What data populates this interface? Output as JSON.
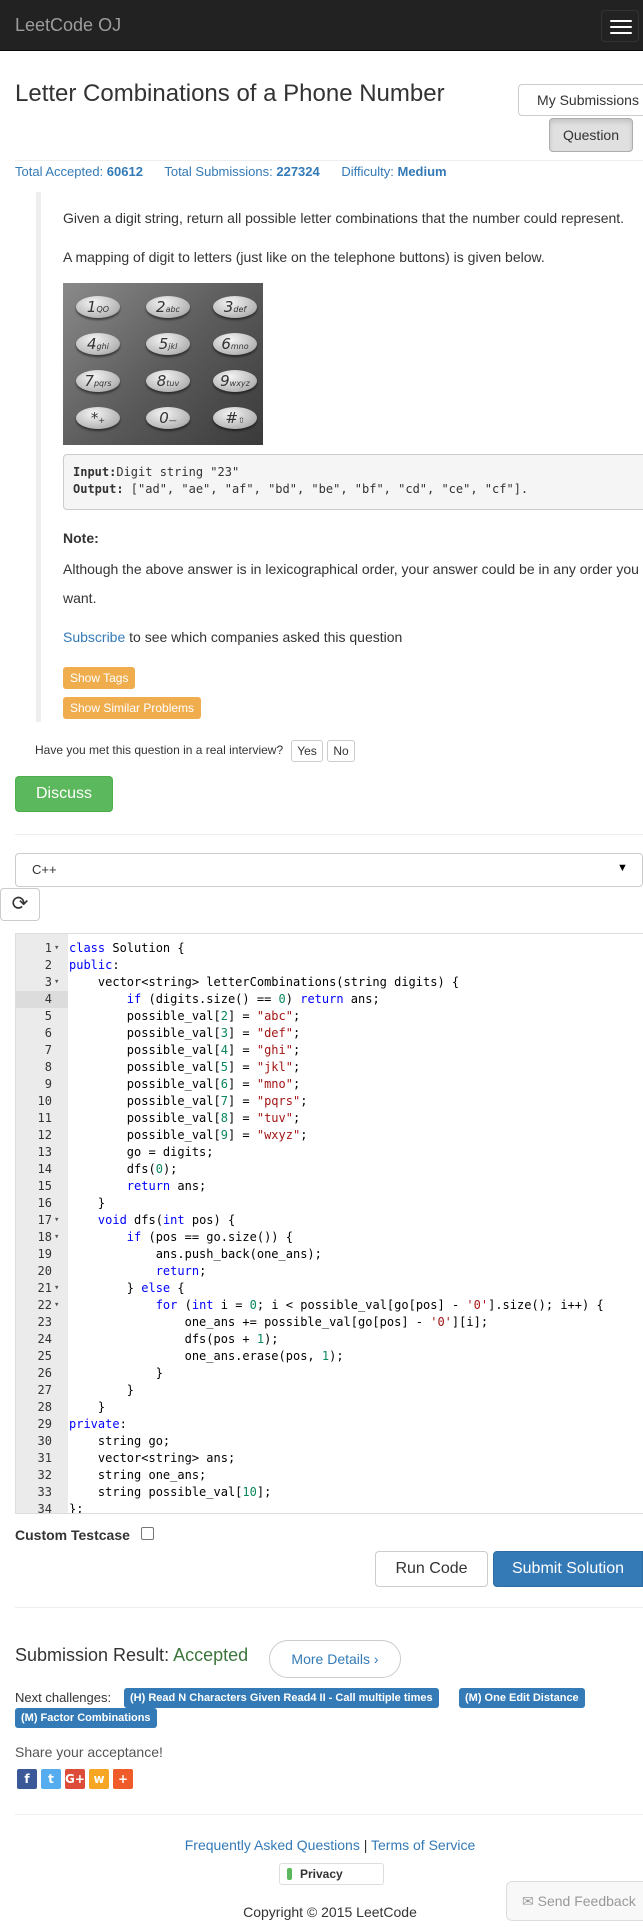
{
  "navbar": {
    "brand": "LeetCode OJ"
  },
  "question": {
    "title": "Letter Combinations of a Phone Number",
    "my_submissions_label": "My Submissions",
    "question_label": "Question",
    "stats": {
      "accepted_label": "Total Accepted:",
      "accepted_value": "60612",
      "submissions_label": "Total Submissions:",
      "submissions_value": "227324",
      "difficulty_label": "Difficulty:",
      "difficulty_value": "Medium"
    },
    "description": {
      "line1": "Given a digit string, return all possible letter combinations that the number could represent.",
      "line2": "A mapping of digit to letters (just like on the telephone buttons) is given below.",
      "keypad": [
        {
          "digit": "1",
          "letters": "QO"
        },
        {
          "digit": "2",
          "letters": "abc"
        },
        {
          "digit": "3",
          "letters": "def"
        },
        {
          "digit": "4",
          "letters": "ghi"
        },
        {
          "digit": "5",
          "letters": "jkl"
        },
        {
          "digit": "6",
          "letters": "mno"
        },
        {
          "digit": "7",
          "letters": "pqrs"
        },
        {
          "digit": "8",
          "letters": "tuv"
        },
        {
          "digit": "9",
          "letters": "wxyz"
        },
        {
          "digit": "*",
          "letters": "+"
        },
        {
          "digit": "0",
          "letters": "—"
        },
        {
          "digit": "#",
          "letters": "⇧"
        }
      ],
      "input_label": "Input:",
      "input_value": "Digit string \"23\"",
      "output_label": "Output:",
      "output_value": " [\"ad\", \"ae\", \"af\", \"bd\", \"be\", \"bf\", \"cd\", \"ce\", \"cf\"].",
      "note_label": "Note:",
      "note_line1": "Although the above answer is in lexicographical order, your answer could be in any order you",
      "note_line2": "want.",
      "subscribe_link": "Subscribe",
      "subscribe_text": " to see which companies asked this question",
      "show_tags_label": "Show Tags",
      "show_similar_label": "Show Similar Problems"
    },
    "interview_question": "Have you met this question in a real interview?",
    "yes_label": "Yes",
    "no_label": "No",
    "discuss_label": "Discuss"
  },
  "editor": {
    "language": "C++",
    "active_line": 4,
    "lines": [
      "class Solution {",
      "public:",
      "    vector<string> letterCombinations(string digits) {",
      "        if (digits.size() == 0) return ans;",
      "        possible_val[2] = \"abc\";",
      "        possible_val[3] = \"def\";",
      "        possible_val[4] = \"ghi\";",
      "        possible_val[5] = \"jkl\";",
      "        possible_val[6] = \"mno\";",
      "        possible_val[7] = \"pqrs\";",
      "        possible_val[8] = \"tuv\";",
      "        possible_val[9] = \"wxyz\";",
      "        go = digits;",
      "        dfs(0);",
      "        return ans;",
      "    }",
      "    void dfs(int pos) {",
      "        if (pos == go.size()) {",
      "            ans.push_back(one_ans);",
      "            return;",
      "        } else {",
      "            for (int i = 0; i < possible_val[go[pos] - '0'].size(); i++) {",
      "                one_ans += possible_val[go[pos] - '0'][i];",
      "                dfs(pos + 1);",
      "                one_ans.erase(pos, 1);",
      "            }",
      "        }",
      "    }",
      "private:",
      "    string go;",
      "    vector<string> ans;",
      "    string one_ans;",
      "    string possible_val[10];",
      "};"
    ],
    "folds": [
      1,
      3,
      17,
      18,
      21,
      22
    ]
  },
  "controls": {
    "custom_testcase_label": "Custom Testcase",
    "run_code_label": "Run Code",
    "submit_label": "Submit Solution"
  },
  "result": {
    "label": "Submission Result: ",
    "value": "Accepted",
    "more_details_label": "More Details",
    "next_label": "Next challenges:",
    "challenges": [
      "(H) Read N Characters Given Read4 II - Call multiple times",
      "(M) One Edit Distance",
      "(M) Factor Combinations"
    ],
    "share_label": "Share your acceptance!",
    "social": [
      {
        "name": "facebook",
        "glyph": "f",
        "color": "#3b5998"
      },
      {
        "name": "twitter",
        "glyph": "t",
        "color": "#55acee"
      },
      {
        "name": "google-plus",
        "glyph": "G+",
        "color": "#dd4b39"
      },
      {
        "name": "weibo",
        "glyph": "w",
        "color": "#f6a623"
      },
      {
        "name": "more",
        "glyph": "+",
        "color": "#ef5b29"
      }
    ]
  },
  "footer": {
    "faq_label": "Frequently Asked Questions",
    "sep": " | ",
    "tos_label": "Terms of Service",
    "privacy_label": "Privacy",
    "copyright": "Copyright © 2015 LeetCode",
    "feedback_label": "Send Feedback"
  }
}
